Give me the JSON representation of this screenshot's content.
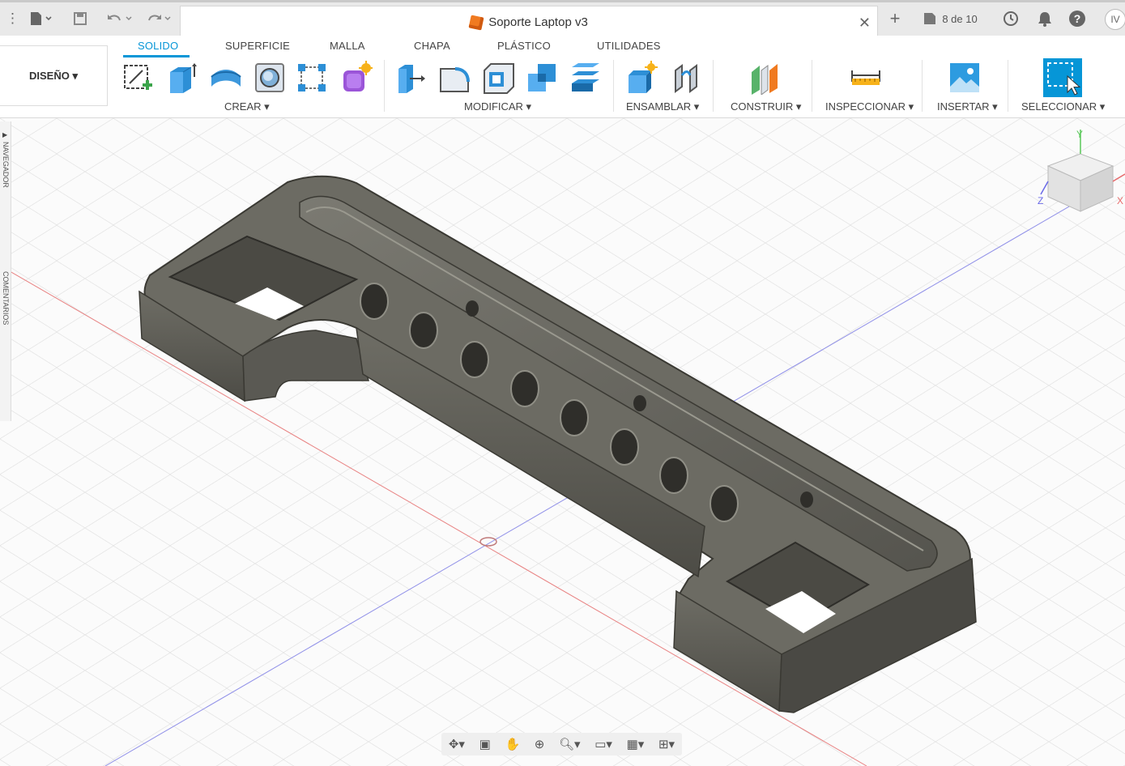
{
  "title_bar": {
    "document_title": "Soporte Laptop v3",
    "version_count": "8 de 10",
    "user_initials": "IV"
  },
  "ribbon": {
    "workspace": "DISEÑO ▾",
    "tabs": [
      "SOLIDO",
      "SUPERFICIE",
      "MALLA",
      "CHAPA",
      "PLÁSTICO",
      "UTILIDADES"
    ],
    "groups": {
      "crear": "CREAR ▾",
      "modificar": "MODIFICAR ▾",
      "ensamblar": "ENSAMBLAR ▾",
      "construir": "CONSTRUIR ▾",
      "inspeccionar": "INSPECCIONAR ▾",
      "insertar": "INSERTAR ▾",
      "seleccionar": "SELECCIONAR ▾"
    }
  },
  "side_panel": {
    "navigator": "NAVEGADOR",
    "comments": "COMENTARIOS"
  },
  "viewcube": {
    "axis_x": "X",
    "axis_y": "Y",
    "axis_z": "Z"
  },
  "colors": {
    "accent": "#0696d7",
    "model_fill": "#5b5a52",
    "model_dark": "#3a3933",
    "model_light": "#8a8a80"
  }
}
